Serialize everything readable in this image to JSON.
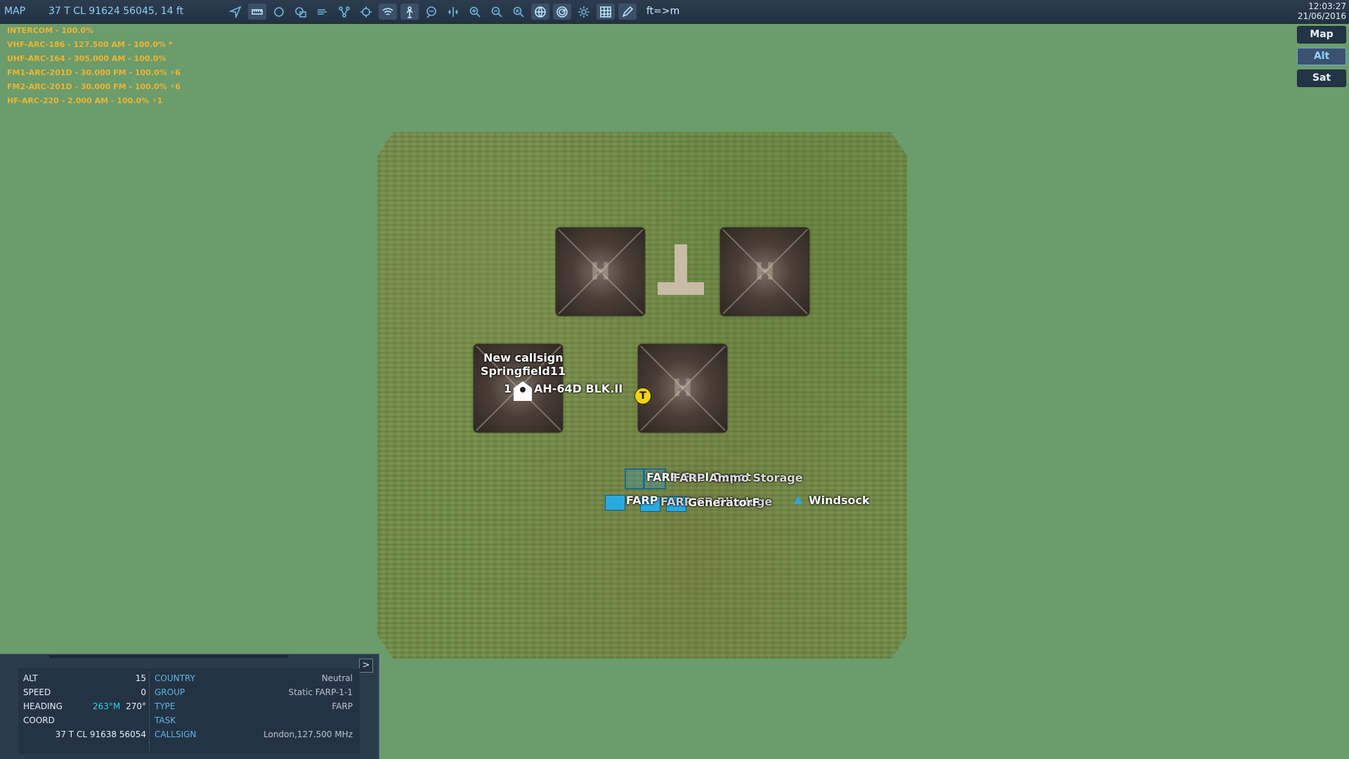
{
  "toolbar": {
    "mode_label": "MAP",
    "cursor_coord": "37 T CL 91624 56045, 14 ft",
    "unit_toggle": "ft=>m",
    "icons": [
      "navigate-icon",
      "ruler-icon",
      "circle-icon",
      "layers-icon",
      "wind-icon",
      "network-icon",
      "target-icon",
      "wifi-icon",
      "antenna-icon",
      "chat-icon",
      "split-icon",
      "zoom-in-icon",
      "zoom-out-icon",
      "zoom-fit-icon",
      "globe-icon",
      "radar-icon",
      "sun-icon",
      "grid-icon",
      "pencil-icon"
    ]
  },
  "clock": {
    "time": "12:03:27",
    "date": "21/06/2016"
  },
  "radios": [
    "INTERCOM - 100.0%",
    "VHF-ARC-186 - 127.500 AM - 100.0% *",
    "UHF-ARC-164 - 305.000 AM - 100.0%",
    "FM1-ARC-201D - 30.000 FM - 100.0% ⚡6",
    "FM2-ARC-201D - 30.000 FM - 100.0% ⚡6",
    "HF-ARC-220 - 2.000 AM - 100.0% ⚡1"
  ],
  "map_types": {
    "map": "Map",
    "alt": "Alt",
    "sat": "Sat"
  },
  "map": {
    "callsign_line1": "New callsign",
    "callsign_line2": "Springfield11",
    "unit_count": "1",
    "unit_name": "AH-64D BLK.II",
    "t_marker": "T",
    "farp_line1": "FARP Fuel Depot",
    "farp_line1_overlap": "FARP Ammo Storage",
    "farp_line2a": "FARP",
    "farp_line2b": "FARP CP Blindage",
    "farp_line2c": "GeneratorF",
    "windsock": "Windsock"
  },
  "info_panel": {
    "expand": ">",
    "alt_label": "ALT",
    "alt_value": "15",
    "speed_label": "SPEED",
    "speed_value": "0",
    "heading_label": "HEADING",
    "heading_mag": "263°M",
    "heading_true": "270°",
    "coord_label": "COORD",
    "coord_value": "37 T CL 91638 56054",
    "country_label": "COUNTRY",
    "country_value": "Neutral",
    "group_label": "GROUP",
    "group_value": "Static FARP-1-1",
    "type_label": "TYPE",
    "type_value": "FARP",
    "task_label": "TASK",
    "task_value": "",
    "callsign_label": "CALLSIGN",
    "callsign_value": "London,127.500 MHz"
  }
}
